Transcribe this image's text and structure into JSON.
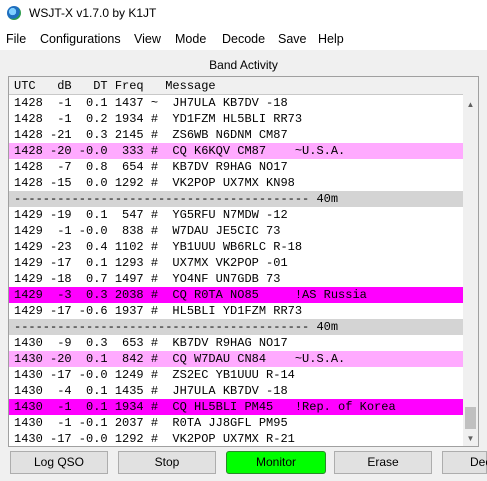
{
  "window": {
    "title": "WSJT-X   v1.7.0   by K1JT"
  },
  "menu": [
    "File",
    "Configurations",
    "View",
    "Mode",
    "Decode",
    "Save",
    "Help"
  ],
  "panel": {
    "title": "Band Activity"
  },
  "table": {
    "header": "UTC   dB   DT Freq   Message",
    "rows": [
      {
        "text": "1428  -1  0.1 1437 ~  JH7ULA KB7DV -18",
        "style": "normal"
      },
      {
        "text": "1428  -1  0.2 1934 #  YD1FZM HL5BLI RR73",
        "style": "normal"
      },
      {
        "text": "1428 -21  0.3 2145 #  ZS6WB N6DNM CM87",
        "style": "normal"
      },
      {
        "text": "1428 -20 -0.0  333 #  CQ K6KQV CM87    ~U.S.A.",
        "style": "cq"
      },
      {
        "text": "1428  -7  0.8  654 #  KB7DV R9HAG NO17",
        "style": "normal"
      },
      {
        "text": "1428 -15  0.0 1292 #  VK2POP UX7MX KN98",
        "style": "normal"
      },
      {
        "text": "----------------------------------------- 40m",
        "style": "sep"
      },
      {
        "text": "1429 -19  0.1  547 #  YG5RFU N7MDW -12",
        "style": "normal"
      },
      {
        "text": "1429  -1 -0.0  838 #  W7DAU JE5CIC 73",
        "style": "normal"
      },
      {
        "text": "1429 -23  0.4 1102 #  YB1UUU WB6RLC R-18",
        "style": "normal"
      },
      {
        "text": "1429 -17  0.1 1293 #  UX7MX VK2POP -01",
        "style": "normal"
      },
      {
        "text": "1429 -18  0.7 1497 #  YO4NF UN7GDB 73",
        "style": "normal"
      },
      {
        "text": "1429  -3  0.3 2038 #  CQ R0TA NO85     !AS Russia",
        "style": "dx"
      },
      {
        "text": "1429 -17 -0.6 1937 #  HL5BLI YD1FZM RR73",
        "style": "normal"
      },
      {
        "text": "----------------------------------------- 40m",
        "style": "sep"
      },
      {
        "text": "1430  -9  0.3  653 #  KB7DV R9HAG NO17",
        "style": "normal"
      },
      {
        "text": "1430 -20  0.1  842 #  CQ W7DAU CN84    ~U.S.A.",
        "style": "cq"
      },
      {
        "text": "1430 -17 -0.0 1249 #  ZS2EC YB1UUU R-14",
        "style": "normal"
      },
      {
        "text": "1430  -4  0.1 1435 #  JH7ULA KB7DV -18",
        "style": "normal"
      },
      {
        "text": "1430  -1  0.1 1934 #  CQ HL5BLI PM45   !Rep. of Korea",
        "style": "dx"
      },
      {
        "text": "1430  -1 -0.1 2037 #  R0TA JJ8GFL PM95",
        "style": "normal"
      },
      {
        "text": "1430 -17 -0.0 1292 #  VK2POP UX7MX R-21",
        "style": "normal"
      }
    ]
  },
  "buttons": {
    "log_qso": "Log QSO",
    "stop": "Stop",
    "monitor": "Monitor",
    "erase": "Erase",
    "decode": "Dec"
  },
  "colors": {
    "cq": "#ffaaff",
    "dx": "#ff00ff",
    "monitor_on": "#00ff00"
  }
}
